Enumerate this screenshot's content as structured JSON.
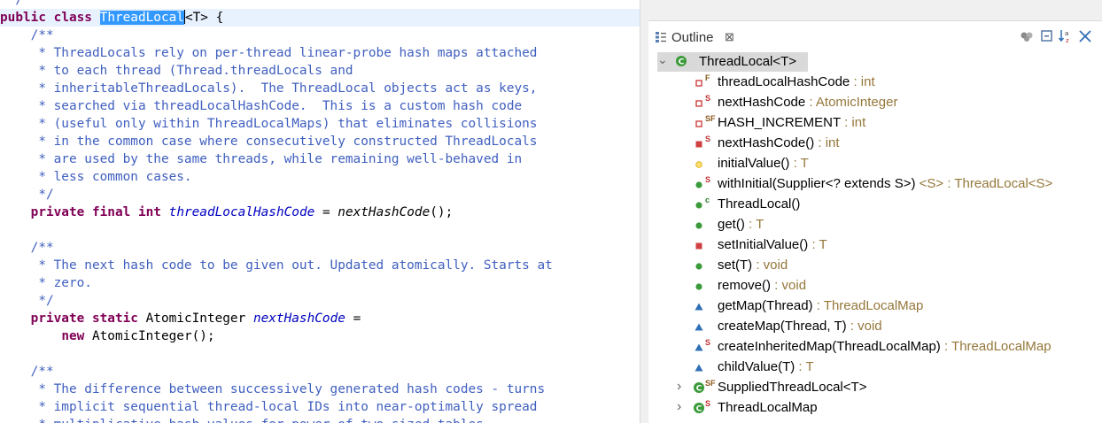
{
  "editor": {
    "lines": [
      {
        "segments": [
          {
            "t": " */",
            "c": "jd"
          }
        ]
      },
      {
        "segments": [
          {
            "t": "public",
            "c": "kw"
          },
          {
            "t": " "
          },
          {
            "t": "class",
            "c": "kw"
          },
          {
            "t": " "
          },
          {
            "t": "ThreadLocal",
            "c": "sel"
          },
          {
            "t": "|",
            "c": "caret"
          },
          {
            "t": "<T> {"
          }
        ],
        "current": true
      },
      {
        "segments": [
          {
            "t": "    /**",
            "c": "jd"
          }
        ]
      },
      {
        "segments": [
          {
            "t": "     * ThreadLocals rely on per-thread linear-probe hash maps attached",
            "c": "jd"
          }
        ]
      },
      {
        "segments": [
          {
            "t": "     * to each thread (Thread.threadLocals and",
            "c": "jd"
          }
        ]
      },
      {
        "segments": [
          {
            "t": "     * inheritableThreadLocals).  The ThreadLocal objects act as keys,",
            "c": "jd"
          }
        ]
      },
      {
        "segments": [
          {
            "t": "     * searched via threadLocalHashCode.  This is a custom hash code",
            "c": "jd"
          }
        ]
      },
      {
        "segments": [
          {
            "t": "     * (useful only within ThreadLocalMaps) that eliminates collisions",
            "c": "jd"
          }
        ]
      },
      {
        "segments": [
          {
            "t": "     * in the common case where consecutively constructed ThreadLocals",
            "c": "jd"
          }
        ]
      },
      {
        "segments": [
          {
            "t": "     * are used by the same threads, while remaining well-behaved in",
            "c": "jd"
          }
        ]
      },
      {
        "segments": [
          {
            "t": "     * less common cases.",
            "c": "jd"
          }
        ]
      },
      {
        "segments": [
          {
            "t": "     */",
            "c": "jd"
          }
        ]
      },
      {
        "segments": [
          {
            "t": "    "
          },
          {
            "t": "private",
            "c": "kw"
          },
          {
            "t": " "
          },
          {
            "t": "final",
            "c": "kw"
          },
          {
            "t": " "
          },
          {
            "t": "int",
            "c": "kw"
          },
          {
            "t": " "
          },
          {
            "t": "threadLocalHashCode",
            "c": "fld"
          },
          {
            "t": " = "
          },
          {
            "t": "nextHashCode",
            "c": "it"
          },
          {
            "t": "();"
          }
        ]
      },
      {
        "segments": [
          {
            "t": ""
          }
        ]
      },
      {
        "segments": [
          {
            "t": "    /**",
            "c": "jd"
          }
        ]
      },
      {
        "segments": [
          {
            "t": "     * The next hash code to be given out. Updated atomically. Starts at",
            "c": "jd"
          }
        ]
      },
      {
        "segments": [
          {
            "t": "     * zero.",
            "c": "jd"
          }
        ]
      },
      {
        "segments": [
          {
            "t": "     */",
            "c": "jd"
          }
        ]
      },
      {
        "segments": [
          {
            "t": "    "
          },
          {
            "t": "private",
            "c": "kw"
          },
          {
            "t": " "
          },
          {
            "t": "static",
            "c": "kw"
          },
          {
            "t": " AtomicInteger "
          },
          {
            "t": "nextHashCode",
            "c": "fld"
          },
          {
            "t": " ="
          }
        ]
      },
      {
        "segments": [
          {
            "t": "        "
          },
          {
            "t": "new",
            "c": "kw"
          },
          {
            "t": " AtomicInteger();"
          }
        ]
      },
      {
        "segments": [
          {
            "t": ""
          }
        ]
      },
      {
        "segments": [
          {
            "t": "    /**",
            "c": "jd"
          }
        ]
      },
      {
        "segments": [
          {
            "t": "     * The difference between successively generated hash codes - turns",
            "c": "jd"
          }
        ]
      },
      {
        "segments": [
          {
            "t": "     * implicit sequential thread-local IDs into near-optimally spread",
            "c": "jd"
          }
        ]
      },
      {
        "segments": [
          {
            "t": "     * multiplicative hash values for power-of-two-sized tables.",
            "c": "jd"
          }
        ]
      }
    ]
  },
  "outline": {
    "tab_label": "Outline",
    "tab_close": "⊠",
    "toolbar_icons": [
      "hide-non-public-icon",
      "collapse-all-icon",
      "sort-icon",
      "hide-fields-icon"
    ],
    "colors": {
      "public": "#3b9b3b",
      "private": "#d04040",
      "protected": "#e0b020",
      "package": "#2f6fb5",
      "type": "#95773a",
      "selection": "#d9d9d9"
    },
    "root": {
      "name": "ThreadLocal<T>",
      "expanded": true
    },
    "members": [
      {
        "name": "threadLocalHashCode",
        "type": " : int",
        "access": "private-field",
        "overlay": "F"
      },
      {
        "name": "nextHashCode",
        "type": " : AtomicInteger",
        "access": "private-field",
        "overlay": "S"
      },
      {
        "name": "HASH_INCREMENT",
        "type": " : int",
        "access": "private-field",
        "overlay": "SF"
      },
      {
        "name": "nextHashCode()",
        "type": " : int",
        "access": "private",
        "overlay": "S"
      },
      {
        "name": "initialValue()",
        "type": " : T",
        "access": "protected",
        "overlay": ""
      },
      {
        "name": "withInitial(Supplier<? extends S>)",
        "type": " <S> : ThreadLocal<S>",
        "access": "public",
        "overlay": "S"
      },
      {
        "name": "ThreadLocal()",
        "type": "",
        "access": "public",
        "overlay": "c"
      },
      {
        "name": "get()",
        "type": " : T",
        "access": "public",
        "overlay": ""
      },
      {
        "name": "setInitialValue()",
        "type": " : T",
        "access": "private",
        "overlay": ""
      },
      {
        "name": "set(T)",
        "type": " : void",
        "access": "public",
        "overlay": ""
      },
      {
        "name": "remove()",
        "type": " : void",
        "access": "public",
        "overlay": ""
      },
      {
        "name": "getMap(Thread)",
        "type": " : ThreadLocalMap",
        "access": "package",
        "overlay": ""
      },
      {
        "name": "createMap(Thread, T)",
        "type": " : void",
        "access": "package",
        "overlay": ""
      },
      {
        "name": "createInheritedMap(ThreadLocalMap)",
        "type": " : ThreadLocalMap",
        "access": "package",
        "overlay": "S"
      },
      {
        "name": "childValue(T)",
        "type": " : T",
        "access": "package",
        "overlay": ""
      }
    ],
    "nested": [
      {
        "name": "SuppliedThreadLocal<T>",
        "overlay": "SF"
      },
      {
        "name": "ThreadLocalMap",
        "overlay": "S"
      }
    ]
  }
}
